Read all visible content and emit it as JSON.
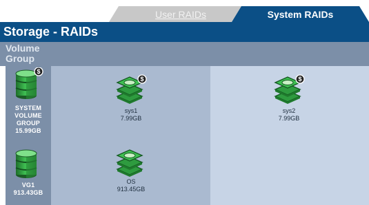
{
  "tabs": [
    {
      "label": "User RAIDs",
      "active": false
    },
    {
      "label": "System RAIDs",
      "active": true
    }
  ],
  "title": "Storage - RAIDs",
  "column_header": "Volume Group",
  "volume_groups": [
    {
      "name": "SYSTEM VOLUME GROUP",
      "size": "15.99GB",
      "icon": "green-cylinder-system-icon"
    },
    {
      "name": "VG1",
      "size": "913.43GB",
      "icon": "green-cylinder-icon"
    }
  ],
  "raids": [
    {
      "name": "sys1",
      "size": "7.99GB",
      "icon": "green-disk-stack-system-icon"
    },
    {
      "name": "sys2",
      "size": "7.99GB",
      "icon": "green-disk-stack-system-icon"
    },
    {
      "name": "OS",
      "size": "913.45GB",
      "icon": "green-disk-stack-icon"
    }
  ],
  "colors": {
    "brand_blue": "#0b4f86",
    "header_gray_blue": "#7c8fa8",
    "panel_mid": "#aabad0",
    "panel_right": "#c7d4e6",
    "icon_green": "#2e9b3f"
  }
}
